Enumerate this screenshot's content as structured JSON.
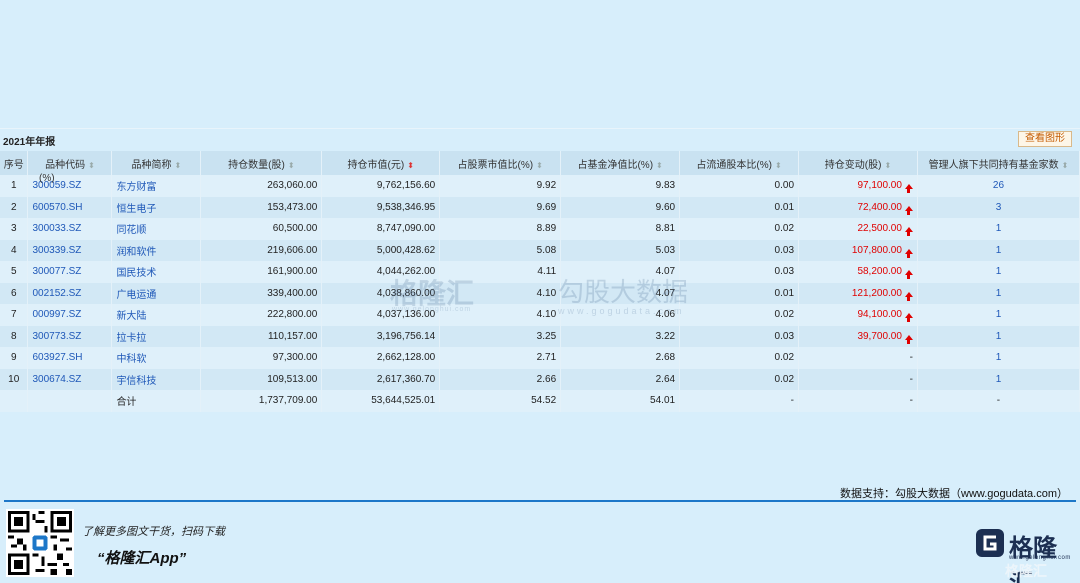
{
  "report": {
    "title": "2021年年报",
    "view_chart_label": "查看图形"
  },
  "columns": [
    {
      "label": "序号"
    },
    {
      "label": "品种代码"
    },
    {
      "label": "品种简称"
    },
    {
      "label": "持仓数量(股)"
    },
    {
      "label": "持仓市值(元)"
    },
    {
      "label": "占股票市值比(%)"
    },
    {
      "label": "占基金净值比(%)"
    },
    {
      "label": "占流通股本比(%)"
    },
    {
      "label": "持仓变动(股)"
    },
    {
      "label": "管理人旗下共同持有基金家数"
    }
  ],
  "column_note": "(%)",
  "rows": [
    {
      "idx": "1",
      "code": "300059.SZ",
      "name": "东方财富",
      "shares": "263,060.00",
      "value": "9,762,156.60",
      "stock_pct": "9.92",
      "nav_pct": "9.83",
      "float_pct": "0.00",
      "change": "97,100.00",
      "up": true,
      "funds": "26"
    },
    {
      "idx": "2",
      "code": "600570.SH",
      "name": "恒生电子",
      "shares": "153,473.00",
      "value": "9,538,346.95",
      "stock_pct": "9.69",
      "nav_pct": "9.60",
      "float_pct": "0.01",
      "change": "72,400.00",
      "up": true,
      "funds": "3"
    },
    {
      "idx": "3",
      "code": "300033.SZ",
      "name": "同花顺",
      "shares": "60,500.00",
      "value": "8,747,090.00",
      "stock_pct": "8.89",
      "nav_pct": "8.81",
      "float_pct": "0.02",
      "change": "22,500.00",
      "up": true,
      "funds": "1"
    },
    {
      "idx": "4",
      "code": "300339.SZ",
      "name": "润和软件",
      "shares": "219,606.00",
      "value": "5,000,428.62",
      "stock_pct": "5.08",
      "nav_pct": "5.03",
      "float_pct": "0.03",
      "change": "107,800.00",
      "up": true,
      "funds": "1"
    },
    {
      "idx": "5",
      "code": "300077.SZ",
      "name": "国民技术",
      "shares": "161,900.00",
      "value": "4,044,262.00",
      "stock_pct": "4.11",
      "nav_pct": "4.07",
      "float_pct": "0.03",
      "change": "58,200.00",
      "up": true,
      "funds": "1"
    },
    {
      "idx": "6",
      "code": "002152.SZ",
      "name": "广电运通",
      "shares": "339,400.00",
      "value": "4,038,860.00",
      "stock_pct": "4.10",
      "nav_pct": "4.07",
      "float_pct": "0.01",
      "change": "121,200.00",
      "up": true,
      "funds": "1"
    },
    {
      "idx": "7",
      "code": "000997.SZ",
      "name": "新大陆",
      "shares": "222,800.00",
      "value": "4,037,136.00",
      "stock_pct": "4.10",
      "nav_pct": "4.06",
      "float_pct": "0.02",
      "change": "94,100.00",
      "up": true,
      "funds": "1"
    },
    {
      "idx": "8",
      "code": "300773.SZ",
      "name": "拉卡拉",
      "shares": "110,157.00",
      "value": "3,196,756.14",
      "stock_pct": "3.25",
      "nav_pct": "3.22",
      "float_pct": "0.03",
      "change": "39,700.00",
      "up": true,
      "funds": "1"
    },
    {
      "idx": "9",
      "code": "603927.SH",
      "name": "中科软",
      "shares": "97,300.00",
      "value": "2,662,128.00",
      "stock_pct": "2.71",
      "nav_pct": "2.68",
      "float_pct": "0.02",
      "change": "-",
      "up": false,
      "funds": "1"
    },
    {
      "idx": "10",
      "code": "300674.SZ",
      "name": "宇信科技",
      "shares": "109,513.00",
      "value": "2,617,360.70",
      "stock_pct": "2.66",
      "nav_pct": "2.64",
      "float_pct": "0.02",
      "change": "-",
      "up": false,
      "funds": "1"
    }
  ],
  "total": {
    "label": "合计",
    "shares": "1,737,709.00",
    "value": "53,644,525.01",
    "stock_pct": "54.52",
    "nav_pct": "54.01",
    "float_pct": "-",
    "change": "-",
    "funds": "-"
  },
  "watermark": {
    "logo_text": "格隆汇",
    "logo_url": "www.gelonghui.com",
    "brand_text": "勾股大数据",
    "brand_url": "www.gogudata.com"
  },
  "footer": {
    "data_support": "数据支持：勾股大数据（www.gogudata.com）",
    "promo_text": "了解更多图文干货，扫码下载",
    "promo_app": "“格隆汇App”",
    "logo_name": "格隆汇",
    "logo_url": "www.gelonghui.com",
    "logo_alt": "格隆汇"
  },
  "colors": {
    "background": "#d7eefb",
    "header": "#c9e2f1",
    "link": "#1f58b8",
    "increase": "#e00000",
    "footer_line": "#1d77c8"
  }
}
